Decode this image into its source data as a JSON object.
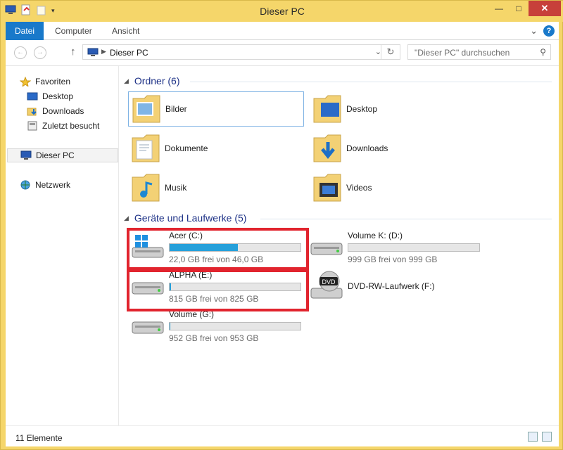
{
  "window": {
    "title": "Dieser PC",
    "minimize": "—",
    "maximize": "□",
    "close": "✕"
  },
  "ribbon": {
    "tabs": [
      "Datei",
      "Computer",
      "Ansicht"
    ],
    "expand": "⌄",
    "help": "?"
  },
  "address": {
    "back": "←",
    "forward": "→",
    "up": "↑",
    "path": "Dieser PC",
    "refresh": "↻",
    "search_placeholder": "\"Dieser PC\" durchsuchen"
  },
  "nav_pane": {
    "favorites": "Favoriten",
    "favorites_items": [
      "Desktop",
      "Downloads",
      "Zuletzt besucht"
    ],
    "this_pc": "Dieser PC",
    "network": "Netzwerk"
  },
  "folders": {
    "heading": "Ordner (6)",
    "items": [
      "Bilder",
      "Desktop",
      "Dokumente",
      "Downloads",
      "Musik",
      "Videos"
    ]
  },
  "drives": {
    "heading": "Geräte und Laufwerke (5)",
    "items": [
      {
        "name": "Acer (C:)",
        "free": "22,0 GB frei von 46,0 GB",
        "used_fraction": 0.52
      },
      {
        "name": "Volume K: (D:)",
        "free": "999 GB frei von 999 GB",
        "used_fraction": 0.0
      },
      {
        "name": "ALPHA (E:)",
        "free": "815 GB frei von 825 GB",
        "used_fraction": 0.012
      },
      {
        "name": "DVD-RW-Laufwerk (F:)"
      },
      {
        "name": "Volume (G:)",
        "free": "952 GB frei von 953 GB",
        "used_fraction": 0.001
      }
    ]
  },
  "status": {
    "count": "11 Elemente"
  },
  "colors": {
    "accent": "#1979ca",
    "highlight": "#e1242e",
    "bar_fill": "#26a0da",
    "title_bar": "#f5d66a"
  }
}
